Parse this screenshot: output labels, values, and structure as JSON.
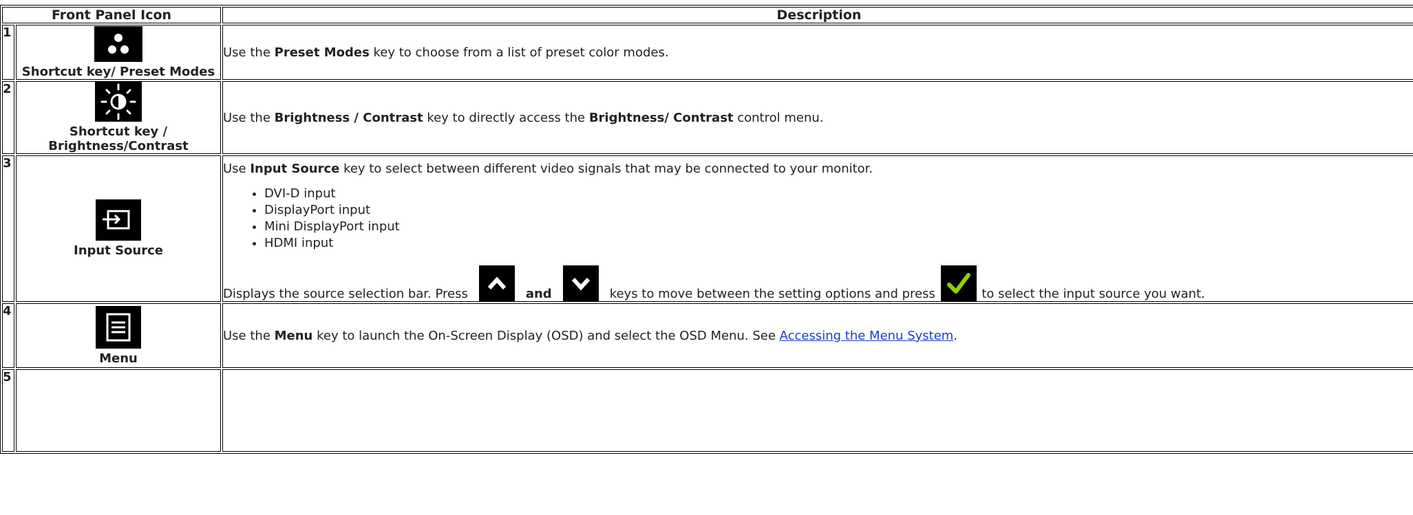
{
  "header": {
    "col_icon": "Front Panel Icon",
    "col_desc": "Description"
  },
  "rows": [
    {
      "num": "1",
      "icon": "preset-modes-icon",
      "caption": "Shortcut key/ Preset Modes",
      "desc": {
        "pre": "Use the ",
        "bold1": "Preset Modes",
        "post": " key to choose from a list of preset color modes."
      }
    },
    {
      "num": "2",
      "icon": "brightness-contrast-icon",
      "caption": "Shortcut key / Brightness/Contrast",
      "desc": {
        "pre": "Use the ",
        "bold1": "Brightness / Contrast",
        "mid": " key to directly access the ",
        "bold2": "Brightness/ Contrast",
        "post": " control menu."
      }
    },
    {
      "num": "3",
      "icon": "input-source-icon",
      "caption": "Input Source",
      "desc": {
        "pre": "Use ",
        "bold1": "Input Source",
        "post": " key to select between different video signals that may be connected to your monitor.",
        "list": [
          "DVI-D input",
          "DisplayPort input",
          "Mini DisplayPort input",
          "HDMI input"
        ],
        "line2_pre": "Displays the source selection bar. Press ",
        "line2_and": " and ",
        "line2_mid": " keys to move between the setting options and press ",
        "line2_post": " to select the input source you want."
      }
    },
    {
      "num": "4",
      "icon": "menu-icon",
      "caption": "Menu",
      "desc": {
        "pre": "Use the ",
        "bold1": "Menu",
        "mid": " key to launch the On-Screen Display (OSD) and select the OSD Menu. See ",
        "link": "Accessing the Menu System",
        "post": "."
      }
    },
    {
      "num": "5"
    }
  ],
  "icons": {
    "up": "chevron-up-icon",
    "down": "chevron-down-icon",
    "check": "checkmark-icon"
  },
  "colors": {
    "check_green": "#8fd400",
    "link": "#1a3fc8"
  }
}
